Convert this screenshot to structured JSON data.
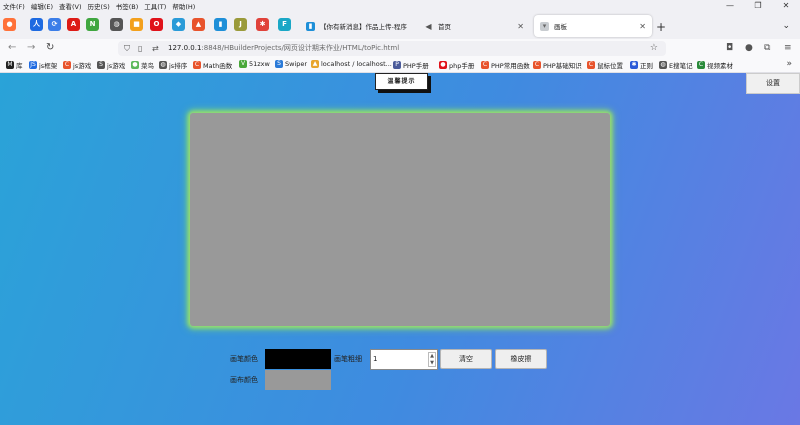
{
  "menu": [
    "文件(F)",
    "编辑(E)",
    "查看(V)",
    "历史(S)",
    "书签(B)",
    "工具(T)",
    "帮助(H)"
  ],
  "window_controls": [
    "—",
    "❐",
    "✕"
  ],
  "pinned_tabs": [
    {
      "icon": "firefox-icon",
      "glyph": "●",
      "color": "#ff7139"
    },
    {
      "icon": "baidu-icon",
      "glyph": "人",
      "color": "#1e6ae1"
    },
    {
      "icon": "swirl-icon",
      "glyph": "⟳",
      "color": "#3b7de8"
    },
    {
      "icon": "angular-icon",
      "glyph": "A",
      "color": "#dd1b16"
    },
    {
      "icon": "n-logo-icon",
      "glyph": "N",
      "color": "#3fa63f"
    },
    {
      "icon": "globe-icon",
      "glyph": "◍",
      "color": "#555"
    },
    {
      "icon": "folder-icon",
      "glyph": "■",
      "color": "#f3a01c"
    },
    {
      "icon": "opera-icon",
      "glyph": "O",
      "color": "#e0121a"
    },
    {
      "icon": "network-icon",
      "glyph": "◆",
      "color": "#2a9bd8"
    },
    {
      "icon": "vue-icon",
      "glyph": "▲",
      "color": "#e8532c"
    },
    {
      "icon": "tag-icon",
      "glyph": "▮",
      "color": "#1e8fd8"
    },
    {
      "icon": "js-icon",
      "glyph": "J",
      "color": "#9a9a3a"
    },
    {
      "icon": "pinwheel-icon",
      "glyph": "✱",
      "color": "#e0423a"
    },
    {
      "icon": "typescript-icon",
      "glyph": "F",
      "color": "#1aa7c6"
    }
  ],
  "tabs": [
    {
      "title": "【你有新消息】作品上传-程序",
      "icon_color": "#1e8fd8",
      "active": false
    },
    {
      "title": "首页",
      "icon_color": "#555",
      "active": false
    },
    {
      "title": "画板",
      "icon_color": "#9aa0a6",
      "active": true
    }
  ],
  "nav": {
    "back": "←",
    "forward": "→",
    "reload": "↻",
    "url_host": "127.0.0.1",
    "url_path": ":8848/HBuilderProjects/网页设计期末作业/HTML/toPic.html"
  },
  "bookmarks": [
    {
      "label": "库",
      "color": "#222",
      "glyph": "M"
    },
    {
      "label": "js框架",
      "color": "#1e6ae1",
      "glyph": "JS"
    },
    {
      "label": "js游戏",
      "color": "#e8532c",
      "glyph": "C"
    },
    {
      "label": "js游戏",
      "color": "#555",
      "glyph": "S"
    },
    {
      "label": "菜鸟",
      "color": "#5cb85c",
      "glyph": "●"
    },
    {
      "label": "js排序",
      "color": "#555",
      "glyph": "◍"
    },
    {
      "label": "Math函数",
      "color": "#e8532c",
      "glyph": "C"
    },
    {
      "label": "51zxw",
      "color": "#4aa83a",
      "glyph": "V"
    },
    {
      "label": "Swiper",
      "color": "#2a7ad8",
      "glyph": "S"
    },
    {
      "label": "localhost / localhost...",
      "color": "#e8a52c",
      "glyph": "▲"
    },
    {
      "label": "PHP手册",
      "color": "#4a5a9a",
      "glyph": "P"
    },
    {
      "label": "php手册",
      "color": "#e0121a",
      "glyph": "●"
    },
    {
      "label": "PHP常用函数",
      "color": "#e8532c",
      "glyph": "C"
    },
    {
      "label": "PHP基础知识",
      "color": "#e8532c",
      "glyph": "C"
    },
    {
      "label": "鼠标位置",
      "color": "#e8532c",
      "glyph": "C"
    },
    {
      "label": "正则",
      "color": "#2a5ad8",
      "glyph": "✱"
    },
    {
      "label": "E搜笔记",
      "color": "#555",
      "glyph": "◍"
    },
    {
      "label": "视频素材",
      "color": "#2a8a3a",
      "glyph": "C"
    }
  ],
  "page": {
    "tip_button": "温馨提示",
    "settings_button": "设置",
    "pen_color_label": "画笔颜色",
    "pen_width_label": "画笔粗细",
    "pen_width_value": "1",
    "clear_button": "清空",
    "eraser_button": "橡皮擦",
    "canvas_color_label": "画布颜色",
    "pen_color": "#000000",
    "canvas_color": "#999999"
  }
}
